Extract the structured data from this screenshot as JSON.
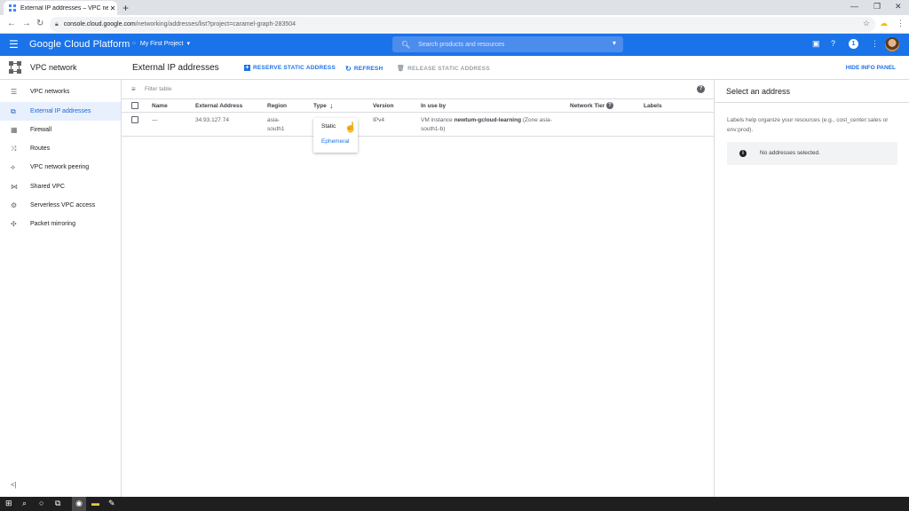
{
  "browser": {
    "tab_title": "External IP addresses – VPC netw...",
    "tab_close": "✕",
    "new_tab": "+",
    "url_host": "console.cloud.google.com",
    "url_path": "/networking/addresses/list?project=caramel-graph-283504"
  },
  "header": {
    "brand": "Google Cloud Platform",
    "project": "My First Project",
    "search_placeholder": "Search products and resources",
    "notifications_count": "1"
  },
  "subheader": {
    "section_title": "VPC network",
    "page_title": "External IP addresses",
    "reserve_label": "RESERVE STATIC ADDRESS",
    "refresh_label": "REFRESH",
    "release_label": "RELEASE STATIC ADDRESS",
    "hide_info_label": "HIDE INFO PANEL"
  },
  "sidebar": {
    "items": [
      {
        "label": "VPC networks"
      },
      {
        "label": "External IP addresses"
      },
      {
        "label": "Firewall"
      },
      {
        "label": "Routes"
      },
      {
        "label": "VPC network peering"
      },
      {
        "label": "Shared VPC"
      },
      {
        "label": "Serverless VPC access"
      },
      {
        "label": "Packet mirroring"
      }
    ],
    "collapse": "<|"
  },
  "table": {
    "filter_placeholder": "Filter table",
    "columns": [
      "Name",
      "External Address",
      "Region",
      "Type",
      "Version",
      "In use by",
      "Network Tier",
      "Labels"
    ],
    "rows": [
      {
        "name": "—",
        "address": "34.93.127.74",
        "region_1": "asia-",
        "region_2": "south1",
        "version": "IPv4",
        "in_use_prefix": "VM instance ",
        "in_use_vm": "newtum-gcloud-learning",
        "in_use_zone_1": " (Zone asia-",
        "in_use_zone_2": "south1-b)"
      }
    ]
  },
  "type_menu": {
    "options": [
      "Static",
      "Ephemeral"
    ]
  },
  "info_panel": {
    "title": "Select an address",
    "description": "Labels help organize your resources (e.g., cost_center:sales or env:prod).",
    "empty_message": "No addresses selected."
  },
  "colors": {
    "brand_blue": "#1a73e8",
    "active_nav_bg": "#e8f0fe"
  }
}
